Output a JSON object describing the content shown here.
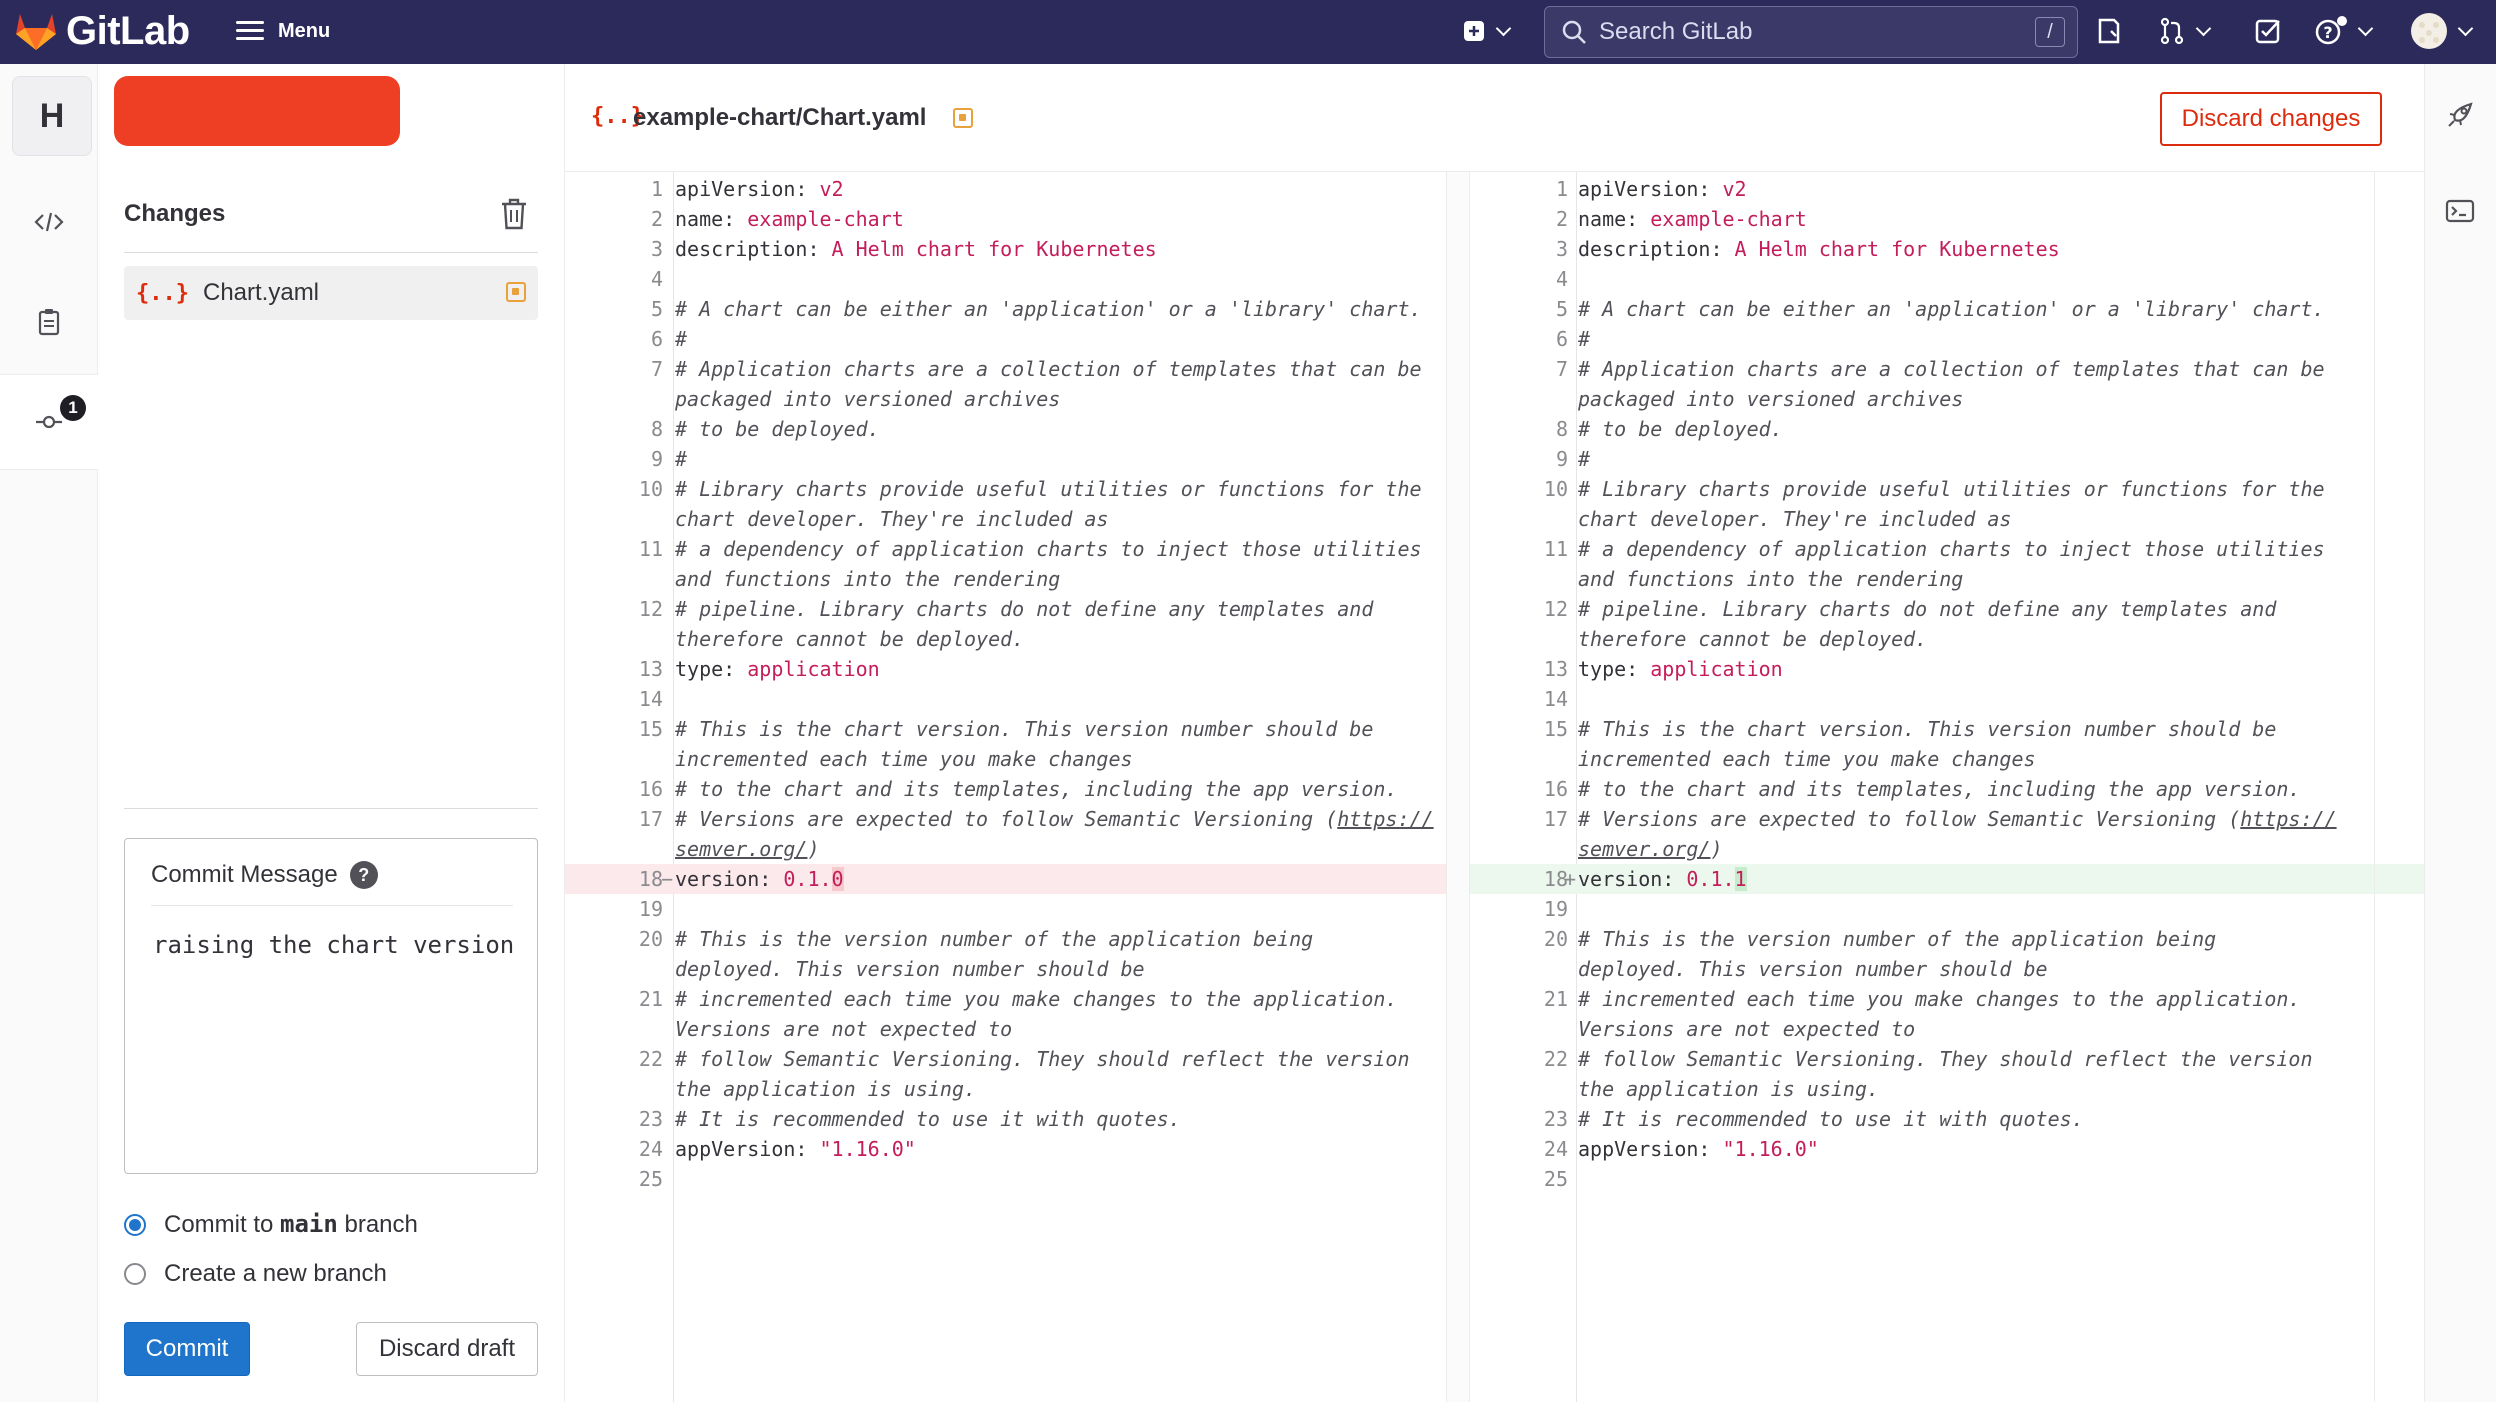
{
  "navbar": {
    "brand": "GitLab",
    "menu_label": "Menu",
    "search_placeholder": "Search GitLab",
    "search_shortcut": "/",
    "icons": [
      "gitlab-logo-icon",
      "plus-square-icon",
      "issues-icon",
      "merge-request-icon",
      "todo-check-icon",
      "help-icon",
      "user-avatar"
    ]
  },
  "rail": {
    "project_initial": "H",
    "items": [
      "code-icon",
      "clipboard-icon",
      "commit-icon"
    ],
    "commit_badge": "1"
  },
  "changes": {
    "title": "Changes",
    "files": [
      {
        "name": "Chart.yaml",
        "icon": "{..}"
      }
    ]
  },
  "commit": {
    "message_label": "Commit Message",
    "help": "?",
    "message": "raising the chart version",
    "options": [
      {
        "prefix": "Commit to ",
        "branch": "main",
        "suffix": " branch",
        "selected": true
      },
      {
        "prefix": "Create a new branch",
        "branch": "",
        "suffix": "",
        "selected": false
      }
    ],
    "commit_button": "Commit",
    "discard_draft_button": "Discard draft"
  },
  "editor": {
    "file_icon": "{..}",
    "file_path": "example-chart/Chart.yaml",
    "discard_changes_button": "Discard changes"
  },
  "diff": {
    "lines": [
      {
        "n": "1",
        "text": "apiVersion: ",
        "val": "v2"
      },
      {
        "n": "2",
        "text": "name: ",
        "val": "example-chart"
      },
      {
        "n": "3",
        "text": "description: ",
        "val": "A Helm chart for Kubernetes"
      },
      {
        "n": "4",
        "text": ""
      },
      {
        "n": "5",
        "cm": "# A chart can be either an 'application' or a 'library' chart."
      },
      {
        "n": "6",
        "cm": "#"
      },
      {
        "n": "7",
        "cm": "# Application charts are a collection of templates that can be",
        "cm2": "packaged into versioned archives"
      },
      {
        "n": "8",
        "cm": "# to be deployed."
      },
      {
        "n": "9",
        "cm": "#"
      },
      {
        "n": "10",
        "cm": "# Library charts provide useful utilities or functions for the",
        "cm2": "chart developer. They're included as"
      },
      {
        "n": "11",
        "cm": "# a dependency of application charts to inject those utilities",
        "cm2": "and functions into the rendering"
      },
      {
        "n": "12",
        "cm": "# pipeline. Library charts do not define any templates and",
        "cm2": "therefore cannot be deployed."
      },
      {
        "n": "13",
        "text": "type: ",
        "val": "application"
      },
      {
        "n": "14",
        "text": ""
      },
      {
        "n": "15",
        "cm": "# This is the chart version. This version number should be",
        "cm2": "incremented each time you make changes"
      },
      {
        "n": "16",
        "cm": "# to the chart and its templates, including the app version."
      },
      {
        "n": "17",
        "cm": "# Versions are expected to follow Semantic Versioning (",
        "link1": "https://",
        "link2": "semver.org/",
        "cm2tail": ")"
      },
      {
        "n": "18",
        "text": "version: ",
        "val_left": "0.1.0",
        "val_right": "0.1.1",
        "changed": true
      },
      {
        "n": "19",
        "text": ""
      },
      {
        "n": "20",
        "cm": "# This is the version number of the application being",
        "cm2": "deployed. This version number should be"
      },
      {
        "n": "21",
        "cm": "# incremented each time you make changes to the application.",
        "cm2": "Versions are not expected to"
      },
      {
        "n": "22",
        "cm": "# follow Semantic Versioning. They should reflect the version",
        "cm2": "the application is using."
      },
      {
        "n": "23",
        "cm": "# It is recommended to use it with quotes."
      },
      {
        "n": "24",
        "text": "appVersion: ",
        "val": "\"1.16.0\""
      },
      {
        "n": "25",
        "text": ""
      }
    ],
    "left_sign": "−",
    "right_sign": "+"
  },
  "colors": {
    "navbar": "#2b2a5a",
    "accent_blue": "#1f75cb",
    "danger": "#dd2b0e",
    "branch_pill": "#ee3f24",
    "string": "#c41d5b"
  }
}
